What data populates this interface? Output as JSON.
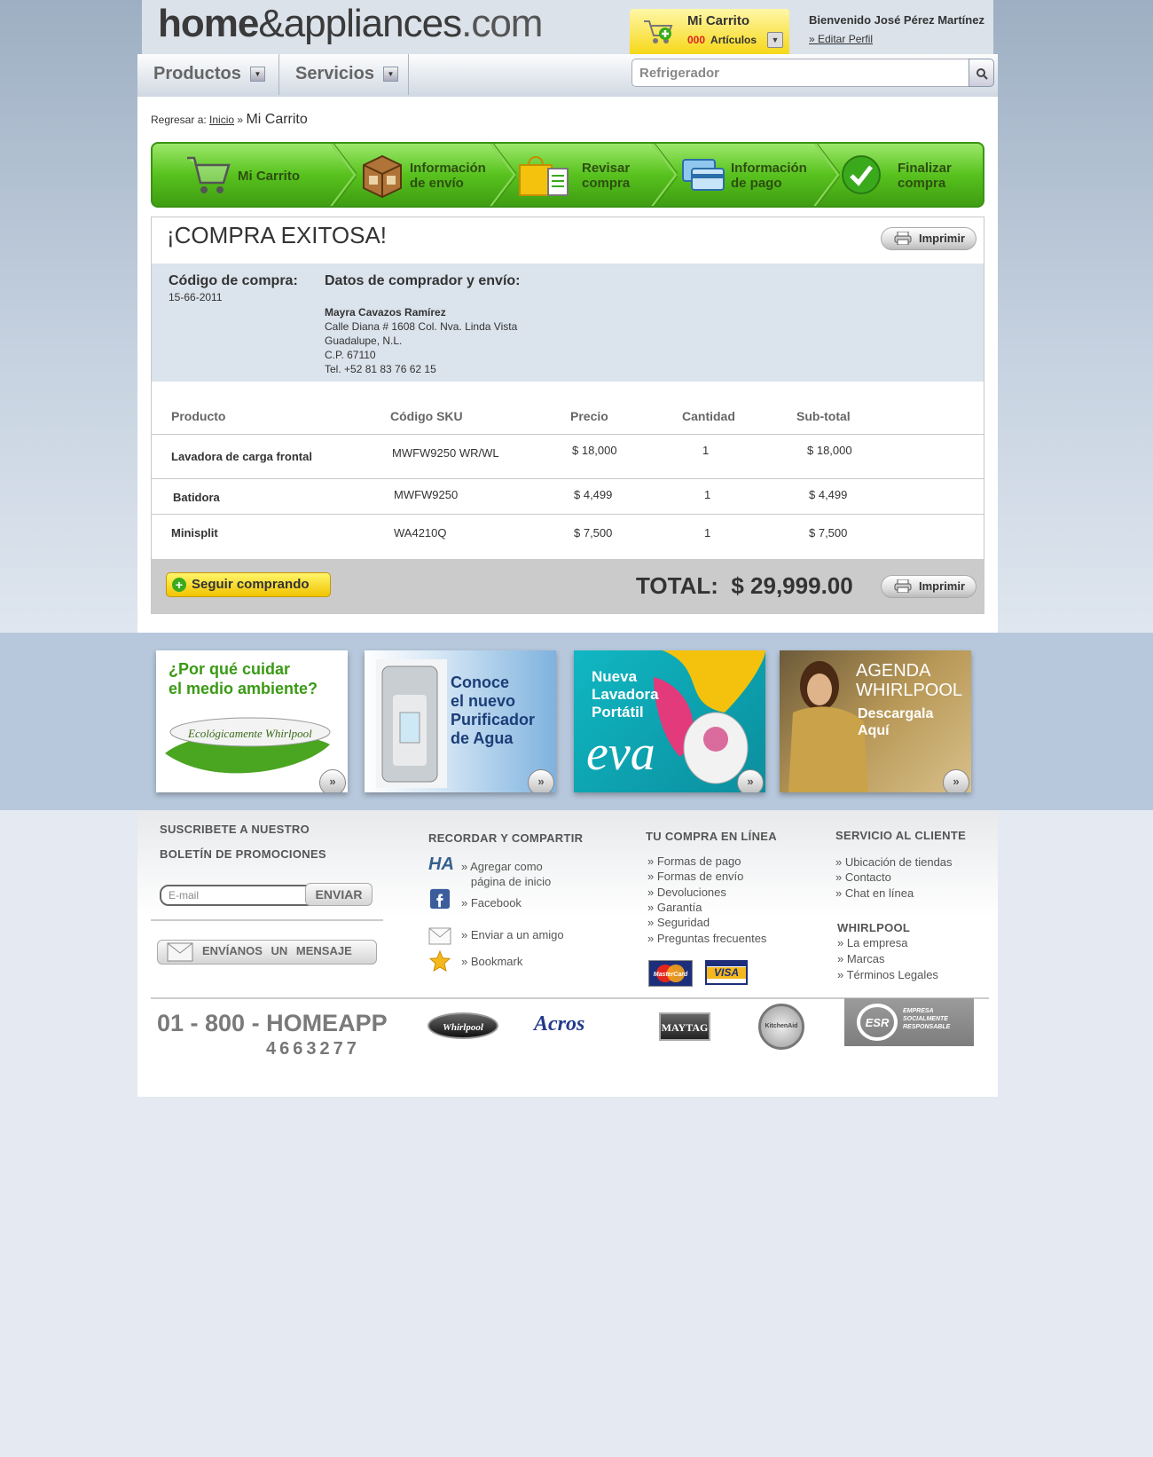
{
  "header": {
    "logo_bold": "home",
    "logo_amp": "&appliances",
    "logo_com": ".com",
    "cart_title": "Mi Carrito",
    "cart_count": "000",
    "cart_label": "Artículos",
    "welcome": "Bienvenido José Pérez Martínez",
    "edit_profile": "» Editar Perfil"
  },
  "nav": {
    "products": "Productos",
    "services": "Servicios",
    "search_placeholder": "Refrigerador"
  },
  "breadcrumb": {
    "prefix": "Regresar a:",
    "home": "Inicio",
    "sep": "»",
    "current": "Mi Carrito"
  },
  "steps": [
    {
      "label1": "Mi Carrito",
      "label2": ""
    },
    {
      "label1": "Información",
      "label2": "de envío"
    },
    {
      "label1": "Revisar",
      "label2": "compra"
    },
    {
      "label1": "Información",
      "label2": "de pago"
    },
    {
      "label1": "Finalizar",
      "label2": "compra"
    }
  ],
  "order": {
    "title": "¡COMPRA EXITOSA!",
    "print": "Imprimir",
    "code_label": "Código de compra:",
    "code_value": "15-66-2011",
    "buyer_label": "Datos de comprador y envío:",
    "buyer_name": "Mayra Cavazos Ramírez",
    "address1": "Calle Diana # 1608 Col. Nva. Linda Vista",
    "address2": "Guadalupe, N.L.",
    "zip": "C.P. 67110",
    "phone": "Tel. +52 81 83 76 62 15"
  },
  "table": {
    "headers": [
      "Producto",
      "Código SKU",
      "Precio",
      "Cantidad",
      "Sub-total"
    ],
    "rows": [
      [
        "Lavadora de carga frontal",
        "MWFW9250 WR/WL",
        "$ 18,000",
        "1",
        "$ 18,000"
      ],
      [
        "Batidora",
        "MWFW9250",
        "$ 4,499",
        "1",
        "$ 4,499"
      ],
      [
        "Minisplit",
        "WA4210Q",
        "$ 7,500",
        "1",
        "$ 7,500"
      ]
    ]
  },
  "totals": {
    "continue": "Seguir comprando",
    "total_label": "TOTAL:",
    "total_value": "$ 29,999.00",
    "print": "Imprimir"
  },
  "promos": {
    "p1_line1": "¿Por qué cuidar",
    "p1_line2": "el medio ambiente?",
    "p1_badge": "Ecológicamente Whirlpool",
    "p2_line1": "Conoce",
    "p2_line2": "el nuevo",
    "p2_line3": "Purificador",
    "p2_line4": "de Agua",
    "p3_line1": "Nueva",
    "p3_line2": "Lavadora",
    "p3_line3": "Portátil",
    "p3_brand": "eva",
    "p4_line1": "AGENDA",
    "p4_line2": "WHIRLPOOL",
    "p4_line3": "Descargala",
    "p4_line4": "Aquí",
    "go": "»"
  },
  "footer": {
    "newsletter_title1": "SUSCRIBETE A NUESTRO",
    "newsletter_title2": "BOLETÍN DE PROMOCIONES",
    "email_placeholder": "E-mail",
    "send": "ENVIAR",
    "message": "ENVÍANOS UN MENSAJE",
    "share_title": "RECORDAR Y COMPARTIR",
    "share_ha": "HA",
    "share_home1": "» Agregar como",
    "share_home2": "página de inicio",
    "share_facebook": "» Facebook",
    "share_friend": "» Enviar a un amigo",
    "share_bookmark": "» Bookmark",
    "online_title": "TU COMPRA EN LÍNEA",
    "online_links": [
      "» Formas de pago",
      "» Formas de envío",
      "» Devoluciones",
      "» Garantía",
      "» Seguridad",
      "» Preguntas frecuentes"
    ],
    "mastercard": "MasterCard",
    "visa": "VISA",
    "service_title": "SERVICIO AL CLIENTE",
    "service_links": [
      "» Ubicación de tiendas",
      "» Contacto",
      "» Chat en línea"
    ],
    "whirlpool_title": "WHIRLPOOL",
    "whirlpool_links": [
      "» La empresa",
      "» Marcas",
      "» Términos Legales"
    ],
    "phone": "01 - 800 - HOMEAPP",
    "phone_digits": "4663277",
    "brand_whirlpool": "Whirlpool",
    "brand_acros": "Acros",
    "brand_maytag": "MAYTAG",
    "brand_kitchenaid": "KitchenAid",
    "esr_mark": "ESR",
    "esr_text1": "EMPRESA",
    "esr_text2": "SOCIALMENTE",
    "esr_text3": "RESPONSABLE"
  },
  "colors": {
    "accent_green": "#58c21e",
    "cart_yellow": "#f6d715",
    "header_bg": "#dbe2ea"
  }
}
